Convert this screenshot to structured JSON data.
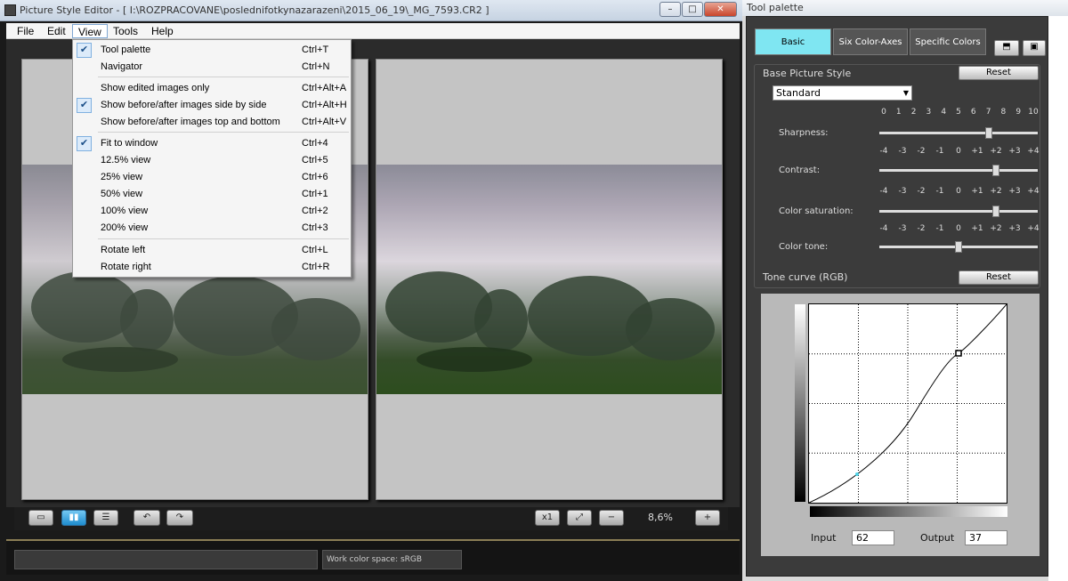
{
  "main_window": {
    "title": "Picture Style Editor - [ I:\\ROZPRACOVANE\\poslednifotkynazarazeni\\2015_06_19\\_MG_7593.CR2 ]",
    "controls": {
      "minimize": "–",
      "maximize": "□",
      "close": "✕"
    }
  },
  "menubar": [
    "File",
    "Edit",
    "View",
    "Tools",
    "Help"
  ],
  "view_menu": [
    {
      "label": "Tool palette",
      "shortcut": "Ctrl+T",
      "checked": true
    },
    {
      "label": "Navigator",
      "shortcut": "Ctrl+N",
      "checked": false
    },
    {
      "label": "Show edited images only",
      "shortcut": "Ctrl+Alt+A",
      "checked": false
    },
    {
      "label": "Show before/after images side by side",
      "shortcut": "Ctrl+Alt+H",
      "checked": true
    },
    {
      "label": "Show before/after images top and bottom",
      "shortcut": "Ctrl+Alt+V",
      "checked": false
    },
    {
      "label": "Fit to window",
      "shortcut": "Ctrl+4",
      "checked": true
    },
    {
      "label": "12.5% view",
      "shortcut": "Ctrl+5",
      "checked": false
    },
    {
      "label": "25% view",
      "shortcut": "Ctrl+6",
      "checked": false
    },
    {
      "label": "50% view",
      "shortcut": "Ctrl+1",
      "checked": false
    },
    {
      "label": "100% view",
      "shortcut": "Ctrl+2",
      "checked": false
    },
    {
      "label": "200% view",
      "shortcut": "Ctrl+3",
      "checked": false
    },
    {
      "label": "Rotate left",
      "shortcut": "Ctrl+L",
      "checked": false
    },
    {
      "label": "Rotate right",
      "shortcut": "Ctrl+R",
      "checked": false
    }
  ],
  "toolbar": {
    "zoom": "8,6%",
    "fit_label": "x1"
  },
  "status": {
    "color_space": "Work color space: sRGB"
  },
  "tool_palette": {
    "title": "Tool palette",
    "tabs": [
      "Basic",
      "Six Color-Axes",
      "Specific Colors"
    ],
    "base_picture_style_label": "Base Picture Style",
    "reset_label": "Reset",
    "style_value": "Standard",
    "sharpness": {
      "label": "Sharpness:",
      "ticks": [
        "0",
        "1",
        "2",
        "3",
        "4",
        "5",
        "6",
        "7",
        "8",
        "9",
        "10"
      ],
      "value": 7
    },
    "contrast": {
      "label": "Contrast:",
      "ticks": [
        "-4",
        "-3",
        "-2",
        "-1",
        "0",
        "+1",
        "+2",
        "+3",
        "+4"
      ],
      "value": 2
    },
    "saturation": {
      "label": "Color saturation:",
      "ticks": [
        "-4",
        "-3",
        "-2",
        "-1",
        "0",
        "+1",
        "+2",
        "+3",
        "+4"
      ],
      "value": 2
    },
    "color_tone": {
      "label": "Color tone:",
      "ticks": [
        "-4",
        "-3",
        "-2",
        "-1",
        "0",
        "+1",
        "+2",
        "+3",
        "+4"
      ],
      "value": 0
    },
    "tone_curve_label": "Tone curve (RGB)",
    "tone_curve_reset": "Reset",
    "input_label": "Input",
    "input_value": "62",
    "output_label": "Output",
    "output_value": "37"
  }
}
